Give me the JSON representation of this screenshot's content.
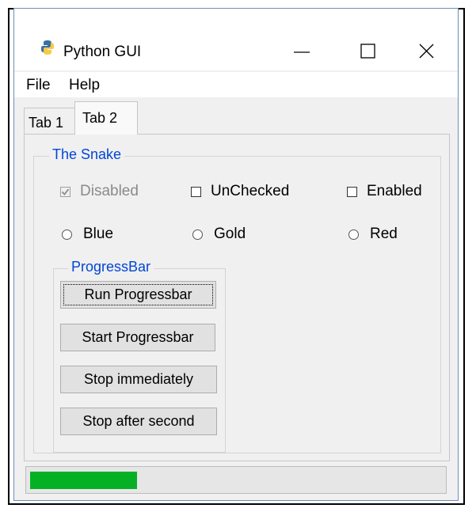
{
  "window": {
    "title": "Python GUI",
    "icon": "python-icon",
    "controls": [
      "minimize-icon",
      "maximize-icon",
      "close-icon"
    ]
  },
  "menu": {
    "file": "File",
    "help": "Help"
  },
  "tabs": [
    {
      "label": "Tab 1",
      "selected": false
    },
    {
      "label": "Tab 2",
      "selected": true
    }
  ],
  "snake_group": {
    "title": "The Snake",
    "checkboxes": [
      {
        "label": "Disabled",
        "checked": true,
        "enabled": false
      },
      {
        "label": "UnChecked",
        "checked": false,
        "enabled": true
      },
      {
        "label": "Enabled",
        "checked": false,
        "enabled": true
      }
    ],
    "radios": [
      {
        "label": "Blue",
        "selected": false
      },
      {
        "label": "Gold",
        "selected": false
      },
      {
        "label": "Red",
        "selected": false
      }
    ]
  },
  "progress_group": {
    "title": "ProgressBar",
    "buttons": {
      "run": "Run Progressbar",
      "start": "Start Progressbar",
      "stop_now": "Stop immediately",
      "stop_after": "Stop after second"
    }
  },
  "progress": {
    "value": 0.26
  },
  "colors": {
    "legend_text": "#0046d5",
    "progress_fill": "#06b025",
    "window_bg": "#f0f0f0",
    "window_border": "#6d8fb9"
  }
}
